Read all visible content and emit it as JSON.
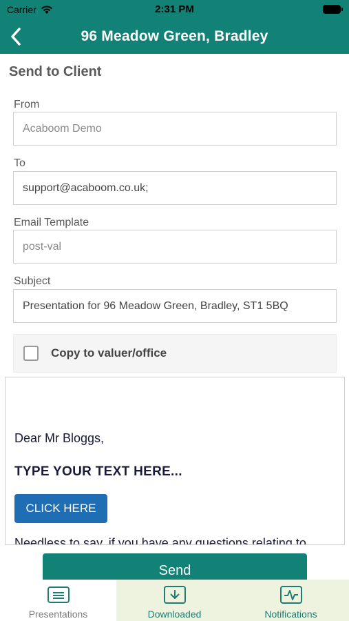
{
  "status_bar": {
    "carrier": "Carrier",
    "time": "2:31 PM"
  },
  "header": {
    "title": "96 Meadow Green, Bradley",
    "back_icon": "chevron-left-icon"
  },
  "page": {
    "heading": "Send to Client"
  },
  "form": {
    "from": {
      "label": "From",
      "value": "Acaboom Demo"
    },
    "to": {
      "label": "To",
      "value": "support@acaboom.co.uk;"
    },
    "template": {
      "label": "Email Template",
      "value": "post-val"
    },
    "subject": {
      "label": "Subject",
      "value": "Presentation for 96 Meadow Green, Bradley, ST1 5BQ"
    },
    "copy": {
      "label": "Copy to valuer/office",
      "checked": false
    }
  },
  "email_preview": {
    "greeting": "Dear Mr Bloggs,",
    "placeholder": "TYPE YOUR TEXT HERE...",
    "button_label": "CLICK HERE",
    "partial_line": "Needless to say, if you have any questions relating to"
  },
  "send_label": "Send",
  "tabs": [
    {
      "label": "Presentations",
      "icon": "presentation-icon"
    },
    {
      "label": "Downloaded",
      "icon": "download-icon"
    },
    {
      "label": "Notifications",
      "icon": "pulse-icon"
    }
  ],
  "colors": {
    "primary": "#128276",
    "button_blue": "#1f6db3",
    "tab_bg": "#eef3e0"
  }
}
